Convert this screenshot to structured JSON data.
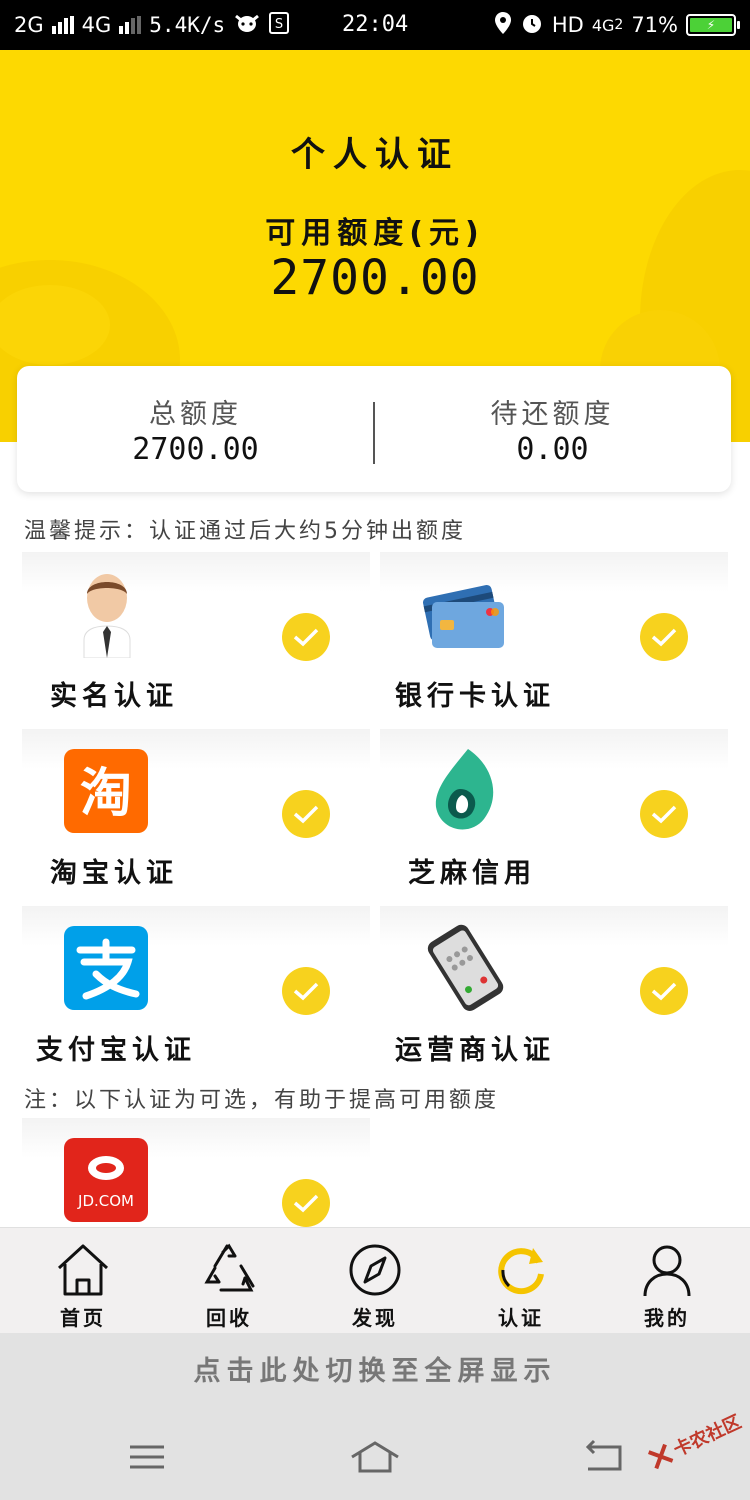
{
  "status_bar": {
    "left_items": [
      "2G",
      "4G"
    ],
    "speed": "5.4K/s",
    "time": "22:04",
    "hd": "HD",
    "network": "4G",
    "network_sim": "2",
    "battery": "71%"
  },
  "header": {
    "title": "个人认证",
    "available_label": "可用额度(元)",
    "available_value": "2700.00"
  },
  "summary": {
    "total_label": "总额度",
    "total_value": "2700.00",
    "pending_label": "待还额度",
    "pending_value": "0.00"
  },
  "tip": "温馨提示：认证通过后大约5分钟出额度",
  "certifications": [
    {
      "label": "实名认证",
      "icon": "person-icon",
      "verified": true
    },
    {
      "label": "银行卡认证",
      "icon": "bank-card-icon",
      "verified": true
    },
    {
      "label": "淘宝认证",
      "icon": "taobao-icon",
      "verified": true
    },
    {
      "label": "芝麻信用",
      "icon": "sesame-credit-icon",
      "verified": true
    },
    {
      "label": "支付宝认证",
      "icon": "alipay-icon",
      "verified": true
    },
    {
      "label": "运营商认证",
      "icon": "phone-icon",
      "verified": true
    }
  ],
  "optional_note": "注：以下认证为可选，有助于提高可用额度",
  "optional_certifications": [
    {
      "label": "JD.COM",
      "icon": "jd-icon",
      "verified": true
    }
  ],
  "bottom_nav": [
    {
      "label": "首页",
      "icon": "home-icon"
    },
    {
      "label": "回收",
      "icon": "recycle-icon"
    },
    {
      "label": "发现",
      "icon": "compass-icon"
    },
    {
      "label": "认证",
      "icon": "refresh-icon",
      "active": true
    },
    {
      "label": "我的",
      "icon": "user-icon"
    }
  ],
  "fullscreen_hint": "点击此处切换至全屏显示",
  "watermark": "卡农社区",
  "colors": {
    "hero_yellow": "#fdd901",
    "check_yellow": "#f7d21e",
    "active_nav": "#f5c400"
  }
}
